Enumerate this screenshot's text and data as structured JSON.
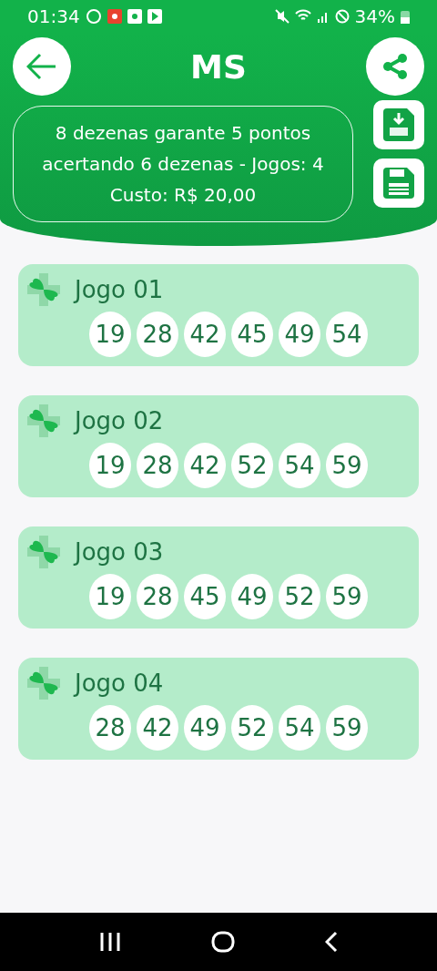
{
  "status_bar": {
    "time": "01:34",
    "battery": "34%"
  },
  "header": {
    "title": "MS",
    "summary": "8 dezenas garante 5 pontos acertando 6 dezenas - Jogos: 4 Custo: R$ 20,00"
  },
  "games": [
    {
      "label": "Jogo 01",
      "numbers": [
        "19",
        "28",
        "42",
        "45",
        "49",
        "54"
      ]
    },
    {
      "label": "Jogo 02",
      "numbers": [
        "19",
        "28",
        "42",
        "52",
        "54",
        "59"
      ]
    },
    {
      "label": "Jogo 03",
      "numbers": [
        "19",
        "28",
        "45",
        "49",
        "52",
        "59"
      ]
    },
    {
      "label": "Jogo 04",
      "numbers": [
        "28",
        "42",
        "49",
        "52",
        "54",
        "59"
      ]
    }
  ]
}
